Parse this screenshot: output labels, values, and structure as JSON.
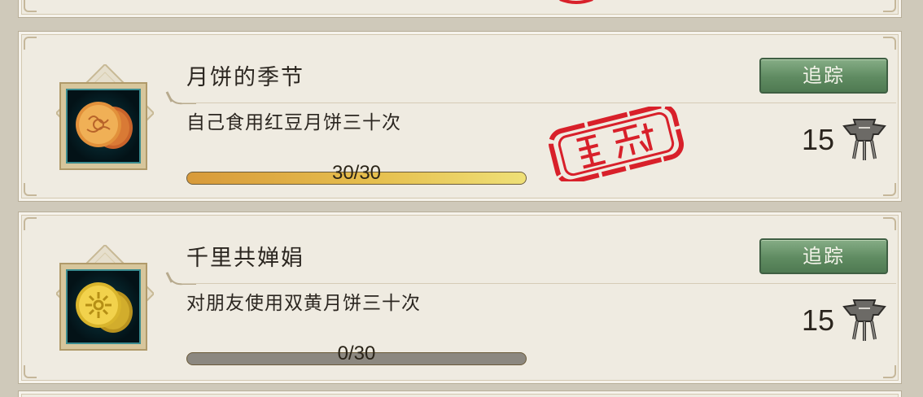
{
  "achievements": [
    {
      "title": "月饼的季节",
      "description": "自己食用红豆月饼三十次",
      "progress_text": "30/30",
      "progress_fraction": 1.0,
      "track_label": "追踪",
      "reward_value": "15",
      "completed": true,
      "icon": "red-bean-mooncake-icon"
    },
    {
      "title": "千里共婵娟",
      "description": "对朋友使用双黄月饼三十次",
      "progress_text": "0/30",
      "progress_fraction": 0.0,
      "track_label": "追踪",
      "reward_value": "15",
      "completed": false,
      "icon": "double-yolk-mooncake-icon"
    }
  ],
  "colors": {
    "card_bg": "#efebe1",
    "track_button": "#5f8b61",
    "progress_fill": "#e6bf4e",
    "stamp_red": "#d8202a"
  },
  "stamp_icon": "completed-seal-stamp",
  "reward_icon": "bronze-vessel-icon"
}
